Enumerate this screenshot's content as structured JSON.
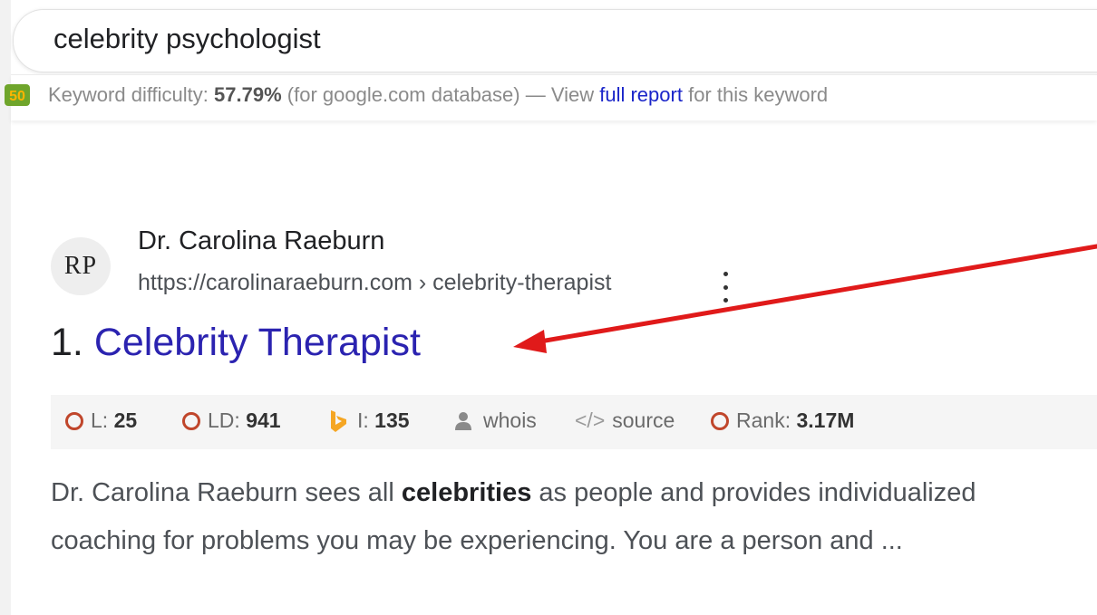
{
  "search": {
    "query": "celebrity psychologist"
  },
  "keyword_bar": {
    "logo_text": "50",
    "label": "Keyword difficulty:",
    "value": "57.79%",
    "database_note": "(for google.com database) — View",
    "link_text": "full report",
    "suffix": "for this keyword"
  },
  "result": {
    "favicon_text": "RP",
    "site_name": "Dr. Carolina Raeburn",
    "url": "https://carolinaraeburn.com › celebrity-therapist",
    "rank": "1.",
    "title": "Celebrity Therapist",
    "metrics": [
      {
        "label": "L:",
        "value": "25",
        "icon": "ring-icon"
      },
      {
        "label": "LD:",
        "value": "941",
        "icon": "ring-icon"
      },
      {
        "label": "I:",
        "value": "135",
        "icon": "bing-icon"
      },
      {
        "label": "whois",
        "icon": "person-icon"
      },
      {
        "label": "source",
        "icon": "code-icon"
      },
      {
        "label": "Rank:",
        "value": "3.17M",
        "icon": "ring-icon"
      }
    ],
    "snippet": {
      "part1": "Dr. Carolina Raeburn sees all",
      "bold": "celebrities",
      "part2": "as people and provides individualized",
      "line2": "coaching for problems you may be experiencing. You are a person and ..."
    }
  },
  "colors": {
    "link": "#2b23b0",
    "report_link": "#1a25c9",
    "arrow": "#e01a1a",
    "metric_ring": "#c0462b",
    "bing": "#f5a623"
  }
}
